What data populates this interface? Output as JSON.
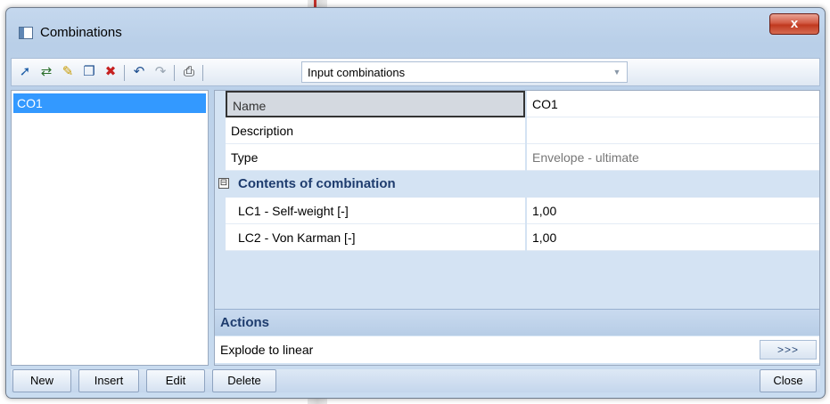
{
  "window": {
    "title": "Combinations",
    "close_glyph": "x"
  },
  "toolbar": {
    "icons": [
      "new-item-icon",
      "import-icon",
      "edit-icon",
      "copy-icon",
      "delete-icon",
      "undo-icon",
      "redo-icon",
      "print-icon"
    ],
    "combo_value": "Input combinations"
  },
  "list": {
    "items": [
      "CO1"
    ]
  },
  "properties": {
    "rows": [
      {
        "label": "Name",
        "value": "CO1"
      },
      {
        "label": "Description",
        "value": ""
      },
      {
        "label": "Type",
        "value": "Envelope - ultimate"
      }
    ],
    "category": {
      "toggle": "⊟",
      "label": "Contents of combination"
    },
    "contents": [
      {
        "label": "LC1 - Self-weight [-]",
        "value": "1,00"
      },
      {
        "label": "LC2 - Von Karman [-]",
        "value": "1,00"
      }
    ]
  },
  "actions": {
    "header": "Actions",
    "items": [
      {
        "label": "Explode to linear",
        "button": ">>>"
      }
    ]
  },
  "buttons": {
    "new": "New",
    "insert": "Insert",
    "edit": "Edit",
    "delete": "Delete",
    "close": "Close"
  },
  "colors": {
    "selection": "#3399ff",
    "category_text": "#1e3c6e",
    "close_button": "#c0391f"
  }
}
